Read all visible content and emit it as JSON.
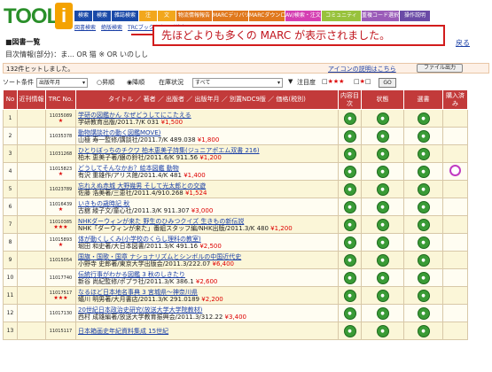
{
  "logo": {
    "text": "TOOL",
    "i": "i"
  },
  "nav": [
    {
      "label": "検索",
      "bg": "#1a4aa8",
      "w": 20
    },
    {
      "label": "検索",
      "bg": "#1a4aa8",
      "w": 20
    },
    {
      "label": "雑誌検索",
      "bg": "#1a4aa8",
      "w": 30
    },
    {
      "label": "注",
      "bg": "#f2a71d",
      "w": 20
    },
    {
      "label": "文",
      "bg": "#f2a71d",
      "w": 20
    },
    {
      "label": "物流情報報告",
      "bg": "#e0781c",
      "w": 40
    },
    {
      "label": "MARCデリバリ",
      "bg": "#e0781c",
      "w": 40
    },
    {
      "label": "MARCダウンロード",
      "bg": "#e0781c",
      "w": 40
    },
    {
      "label": "AV/検索・注文",
      "bg": "#d53fb2",
      "w": 40
    },
    {
      "label": "コミュニティ",
      "bg": "#98c23c",
      "w": 44
    },
    {
      "label": "重複コード選択",
      "bg": "#9a5bb8",
      "w": 42
    },
    {
      "label": "操作説明",
      "bg": "#6a4aa6",
      "w": 34
    }
  ],
  "subnav": [
    "図書検索",
    "絶版検索",
    "TRCブックカタログ検索",
    "マ..."
  ],
  "callout": "先ほどよりも多くの MARC が表示されました。",
  "page_title": "■図書一覧",
  "back": "戻る",
  "db_info": "目次情報(部分)：ま... OR 猫 ※ OR いのしし",
  "hits": "132件ヒットしました。",
  "apicon": "アイコンの説明はこちら",
  "file_out": "ファイル出力",
  "sort": {
    "label": "ソート条件",
    "value": "出版年月",
    "asc": "○昇順",
    "desc": "◉降順",
    "stock": "在庫状況",
    "stock_val": "すべて",
    "attention": "注目度",
    "stars": "★★★",
    "star1": "★",
    "go": "GO"
  },
  "columns": {
    "no": "No",
    "kinkan": "近刊情報",
    "trc": "TRC No.",
    "title": "タイトル ／ 著者 ／ 出版者 ／ 出版年月 ／ 別置NDC9版 ／ 価格(税別)",
    "naiyo": "内容目次",
    "jokyo": "状態",
    "sentaku": "選書",
    "konyu": "購入済み"
  },
  "rows": [
    {
      "no": "1",
      "trc": "11035089",
      "stars": "★",
      "t1": "学研の図鑑かん なぜどうしてにこたえる",
      "t2": "学研教育出版/2011.7/K 031 ",
      "price": "¥1,500",
      "buy": false
    },
    {
      "no": "2",
      "trc": "11035378",
      "stars": "",
      "t1": "動物講談社の動く図鑑MOVE)",
      "t2": "山極 寿一監修/講談社/2011.7/K 489.038 ",
      "price": "¥1,800",
      "buy": false
    },
    {
      "no": "3",
      "trc": "11031268",
      "stars": "",
      "t1": "ひとりぼっちのチクワ 柏木恵美子詩集(ジュニアポエム双書 216)",
      "t2": "柏木 恵美子著/銀の鈴社/2011.6/K 911.56 ",
      "price": "¥1,200",
      "buy": false
    },
    {
      "no": "4",
      "trc": "11015823",
      "stars": "★",
      "t1": "どうしてそんなかお？絵本図鑑 動物",
      "t2": "有沢 重雄作/アリス館/2011.4/K 481 ",
      "price": "¥1,400",
      "buy": true
    },
    {
      "no": "5",
      "trc": "11023789",
      "stars": "",
      "t1": "忘れえぬ赤城 大野幾男 そして光太郎との交遊",
      "t2": "佐藤 浩美著/三恵社/2011.4/910.268 ",
      "price": "¥1,524",
      "buy": false
    },
    {
      "no": "6",
      "trc": "11016439",
      "stars": "★",
      "t1": "いきもの歳時記 秋",
      "t2": "古舘 綾子文/童心社/2011.3/K 911.307 ",
      "price": "¥3,000",
      "buy": false
    },
    {
      "no": "7",
      "trc": "11010385",
      "stars": "★★★",
      "t1": "NHKダーウィンが来た 野生のひみつクイズ 生きもの新伝説",
      "t2": "NHK「ダーウィンが来た」番組スタッフ編/NHK出版/2011.3/K 480 ",
      "price": "¥1,200",
      "buy": false
    },
    {
      "no": "8",
      "trc": "11015893",
      "stars": "★",
      "t1": "体が動くしくみ(小学校のくらし理科の教室)",
      "t2": "堀田 和史著/大日本図書/2011.3/K 491.16 ",
      "price": "¥2,500",
      "buy": false
    },
    {
      "no": "9",
      "trc": "11015054",
      "stars": "",
      "t1": "国旗・国歌・国章 ナショナリズムとシンボルの中国近代史",
      "t2": "小野寺 史郎著/東京大学出版会/2011.3/222.07 ",
      "price": "¥6,400",
      "buy": false
    },
    {
      "no": "10",
      "trc": "11017740",
      "stars": "",
      "t1": "伝統行事がわかる図鑑 3 秋のしきたり",
      "t2": "新谷 尚紀監修/ポプラ社/2011.3/K 386.1 ",
      "price": "¥2,600",
      "buy": false
    },
    {
      "no": "11",
      "trc": "11017517",
      "stars": "★★★",
      "t1": "なるほど日本地名事典 3 宮城県～神奈川県",
      "t2": "蟻川 明男著/大月書店/2011.3/K 291.0189 ",
      "price": "¥2,200",
      "buy": false
    },
    {
      "no": "12",
      "trc": "11017130",
      "stars": "",
      "t1": "20世紀日本政治史研究(放送大学大学院教材)",
      "t2": "西村 成雄編著/放送大学教育振興会/2011.3/312.22 ",
      "price": "¥3,400",
      "buy": false
    },
    {
      "no": "13",
      "trc": "11015117",
      "stars": "",
      "t1": "日本箱画史年紀資料集成 15世紀",
      "t2": "",
      "price": "",
      "buy": false
    }
  ]
}
